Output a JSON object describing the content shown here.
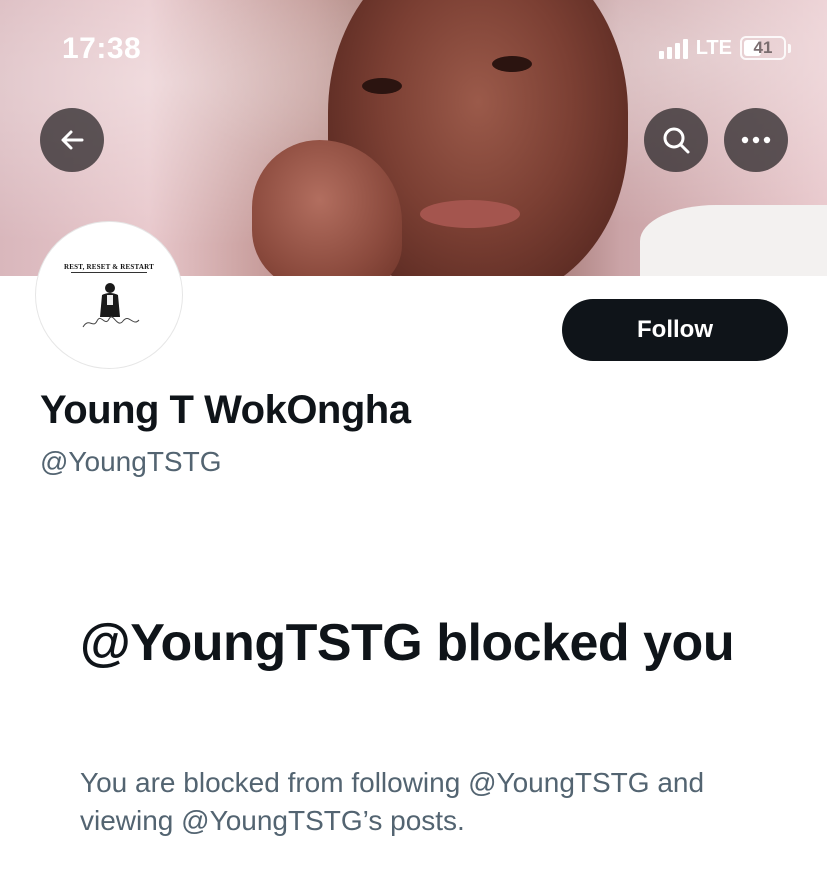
{
  "status_bar": {
    "time": "17:38",
    "network": "LTE",
    "battery": "41"
  },
  "header": {
    "back_icon": "arrow-left-icon",
    "search_icon": "search-icon",
    "more_icon": "more-horizontal-icon"
  },
  "profile": {
    "avatar_text": "REST, RESET & RESTART",
    "display_name": "Young T WokOngha",
    "handle": "@YoungTSTG",
    "follow_label": "Follow"
  },
  "blocked": {
    "title": "@YoungTSTG blocked you",
    "description": "You are blocked from following @YoungTSTG and viewing @YoungTSTG’s posts."
  },
  "colors": {
    "primary_text": "#0f1419",
    "secondary_text": "#536471",
    "button_bg": "#0f1419",
    "button_text": "#ffffff"
  }
}
